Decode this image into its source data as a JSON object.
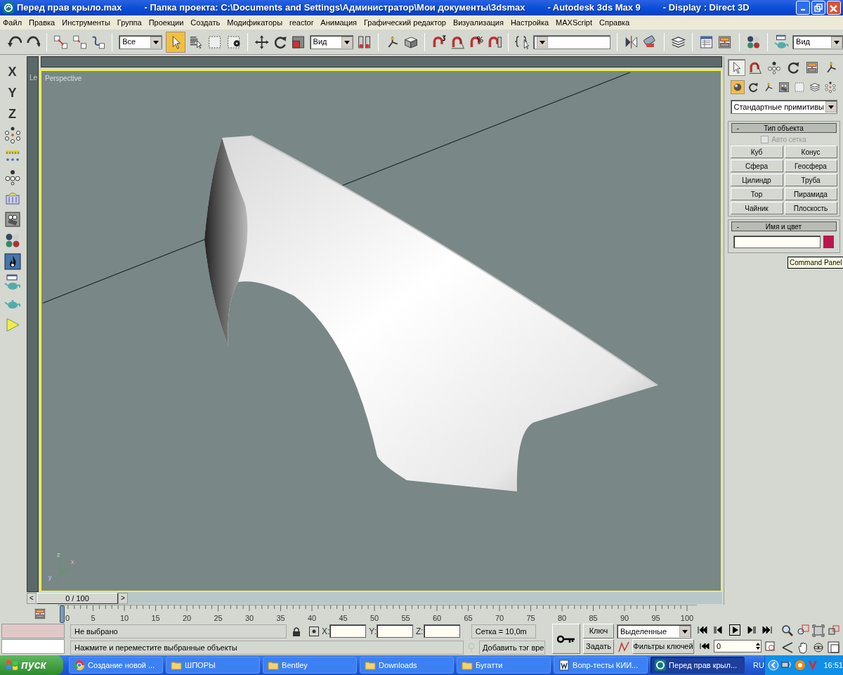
{
  "window": {
    "title_parts": [
      "Перед прав крыло.max",
      "- Папка проекта: C:\\Documents and Settings\\Администратор\\Мои документы\\3dsmax",
      "- Autodesk 3ds Max 9",
      "- Display : Direct 3D"
    ]
  },
  "menu": [
    "Файл",
    "Правка",
    "Инструменты",
    "Группа",
    "Проекции",
    "Создать",
    "Модификаторы",
    "reactor",
    "Анимация",
    "Графический редактор",
    "Визуализация",
    "Настройка",
    "MAXScript",
    "Справка"
  ],
  "toolbar": {
    "selection_filter": "Все",
    "reference_coordinate": "Вид",
    "render_type": "Вид"
  },
  "axis_buttons": [
    "X",
    "Y",
    "Z"
  ],
  "viewport": {
    "cut_label": "Le",
    "label": "Perspective",
    "axis_labels": [
      "z",
      "x",
      "y"
    ]
  },
  "command_panel": {
    "tabs": [
      {
        "selected": true
      },
      {
        "selected": false
      },
      {
        "selected": false
      },
      {
        "selected": false
      },
      {
        "selected": false
      },
      {
        "selected": false
      }
    ],
    "categories": [
      {
        "selected": true
      },
      {
        "selected": false
      },
      {
        "selected": false
      },
      {
        "selected": false
      },
      {
        "selected": false
      },
      {
        "selected": false
      },
      {
        "selected": false
      }
    ],
    "subcategory": "Стандартные примитивы",
    "object_type_rollout": "Тип объекта",
    "collapse_mark": "-",
    "autogrid": {
      "label": "Авто сетка",
      "checked": false,
      "disabled": true
    },
    "buttons": [
      "Куб",
      "Конус",
      "Сфера",
      "Геосфера",
      "Цилиндр",
      "Труба",
      "Тор",
      "Пирамида",
      "Чайник",
      "Плоскость"
    ],
    "name_color_rollout": "Имя и цвет",
    "tooltip": "Command Panel"
  },
  "time_slider": {
    "prev": "<",
    "position": "0 / 100",
    "next": ">"
  },
  "track_labels": [
    "0",
    "5",
    "10",
    "15",
    "20",
    "25",
    "30",
    "35",
    "40",
    "45",
    "50",
    "55",
    "60",
    "65",
    "70",
    "75",
    "80",
    "85",
    "90",
    "95",
    "100"
  ],
  "status": {
    "selection": "Не выбрано",
    "prompt": "Нажмите и переместите выбранные объекты",
    "x_label": "X:",
    "y_label": "Y:",
    "z_label": "Z:",
    "grid": "Сетка = 10,0m",
    "time_tag": "Добавить тэг вре",
    "key_button": "Ключ",
    "set_button": "Задать",
    "key_mode": "Выделенные",
    "key_filters": "Фильтры ключей",
    "frame": "0"
  },
  "taskbar": {
    "start": "пуск",
    "items": [
      {
        "kind": "chrome",
        "label": "Создание новой ...",
        "selected": false
      },
      {
        "kind": "folder",
        "label": "ШПОРЫ",
        "selected": false
      },
      {
        "kind": "folder",
        "label": "Bentley",
        "selected": false
      },
      {
        "kind": "folder",
        "label": "Downloads",
        "selected": false
      },
      {
        "kind": "folder",
        "label": "Бугатти",
        "selected": false
      },
      {
        "kind": "word",
        "label": "Вопр-тесты КИИ...",
        "selected": false
      },
      {
        "kind": "max",
        "label": "Перед прав крыл...",
        "selected": true
      }
    ],
    "language": "RU",
    "clock": "16:51"
  }
}
